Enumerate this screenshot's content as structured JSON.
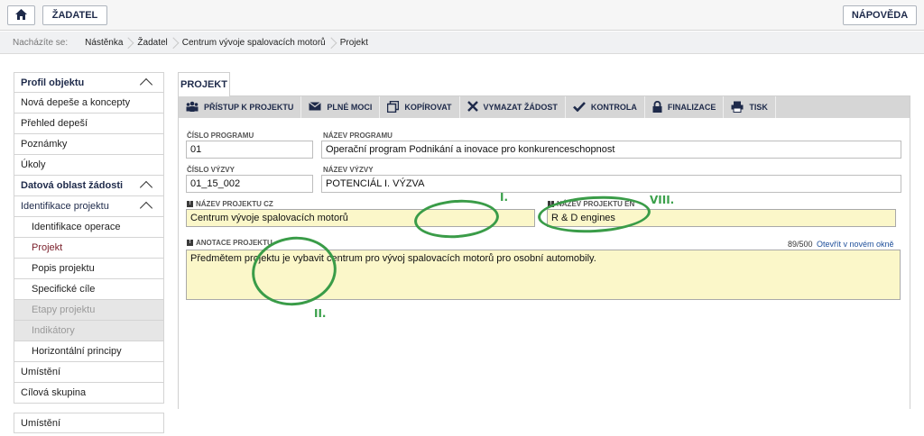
{
  "topbar": {
    "zadatel_label": "ŽADATEL",
    "napoveda_label": "NÁPOVĚDA"
  },
  "breadcrumb": {
    "prefix": "Nacházíte se:",
    "items": [
      "Nástěnka",
      "Žadatel",
      "Centrum vývoje spalovacích motorů",
      "Projekt"
    ]
  },
  "sidebar": {
    "items": [
      {
        "label": "Profil objektu"
      },
      {
        "label": "Nová depeše a koncepty"
      },
      {
        "label": "Přehled depeší"
      },
      {
        "label": "Poznámky"
      },
      {
        "label": "Úkoly"
      },
      {
        "label": "Datová oblast žádosti"
      },
      {
        "label": "Identifikace projektu"
      },
      {
        "label": "Identifikace operace"
      },
      {
        "label": "Projekt"
      },
      {
        "label": "Popis projektu"
      },
      {
        "label": "Specifické cíle"
      },
      {
        "label": "Etapy projektu"
      },
      {
        "label": "Indikátory"
      },
      {
        "label": "Horizontální principy"
      },
      {
        "label": "Umístění"
      },
      {
        "label": "Cílová skupina"
      }
    ],
    "bottom_label": "Umístění"
  },
  "tab": {
    "label": "PROJEKT"
  },
  "toolbar": {
    "items": [
      {
        "label": "PŘÍSTUP K PROJEKTU",
        "icon": "users-icon"
      },
      {
        "label": "PLNÉ MOCI",
        "icon": "envelope-icon"
      },
      {
        "label": "KOPÍROVAT",
        "icon": "copy-icon"
      },
      {
        "label": "VYMAZAT ŽÁDOST",
        "icon": "cross-icon"
      },
      {
        "label": "KONTROLA",
        "icon": "check-icon"
      },
      {
        "label": "FINALIZACE",
        "icon": "lock-icon"
      },
      {
        "label": "TISK",
        "icon": "printer-icon"
      }
    ]
  },
  "form": {
    "cislo_programu_label": "ČÍSLO PROGRAMU",
    "cislo_programu_value": "01",
    "nazev_programu_label": "NÁZEV PROGRAMU",
    "nazev_programu_value": "Operační program Podnikání a inovace pro konkurenceschopnost",
    "cislo_vyzvy_label": "ČÍSLO VÝZVY",
    "cislo_vyzvy_value": "01_15_002",
    "nazev_vyzvy_label": "NÁZEV VÝZVY",
    "nazev_vyzvy_value": "POTENCIÁL I. VÝZVA",
    "nazev_cz_label": "NÁZEV PROJEKTU CZ",
    "nazev_cz_value": "Centrum vývoje spalovacích motorů",
    "nazev_en_label": "NÁZEV PROJEKTU EN",
    "nazev_en_value": "R & D engines",
    "anotace_label": "ANOTACE PROJEKTU",
    "anotace_value": "Předmětem projektu je vybavit centrum pro vývoj spalovacích motorů pro osobní automobily.",
    "anotace_counter": "89/500",
    "open_new_window": "Otevřít v novém okně"
  },
  "annotations": {
    "a1": "I.",
    "a2": "VIII.",
    "a3": "II."
  },
  "colors": {
    "annotation": "#3a9c48",
    "required_field_bg": "#fbf7c9",
    "active_nav": "#7a1f2a"
  }
}
